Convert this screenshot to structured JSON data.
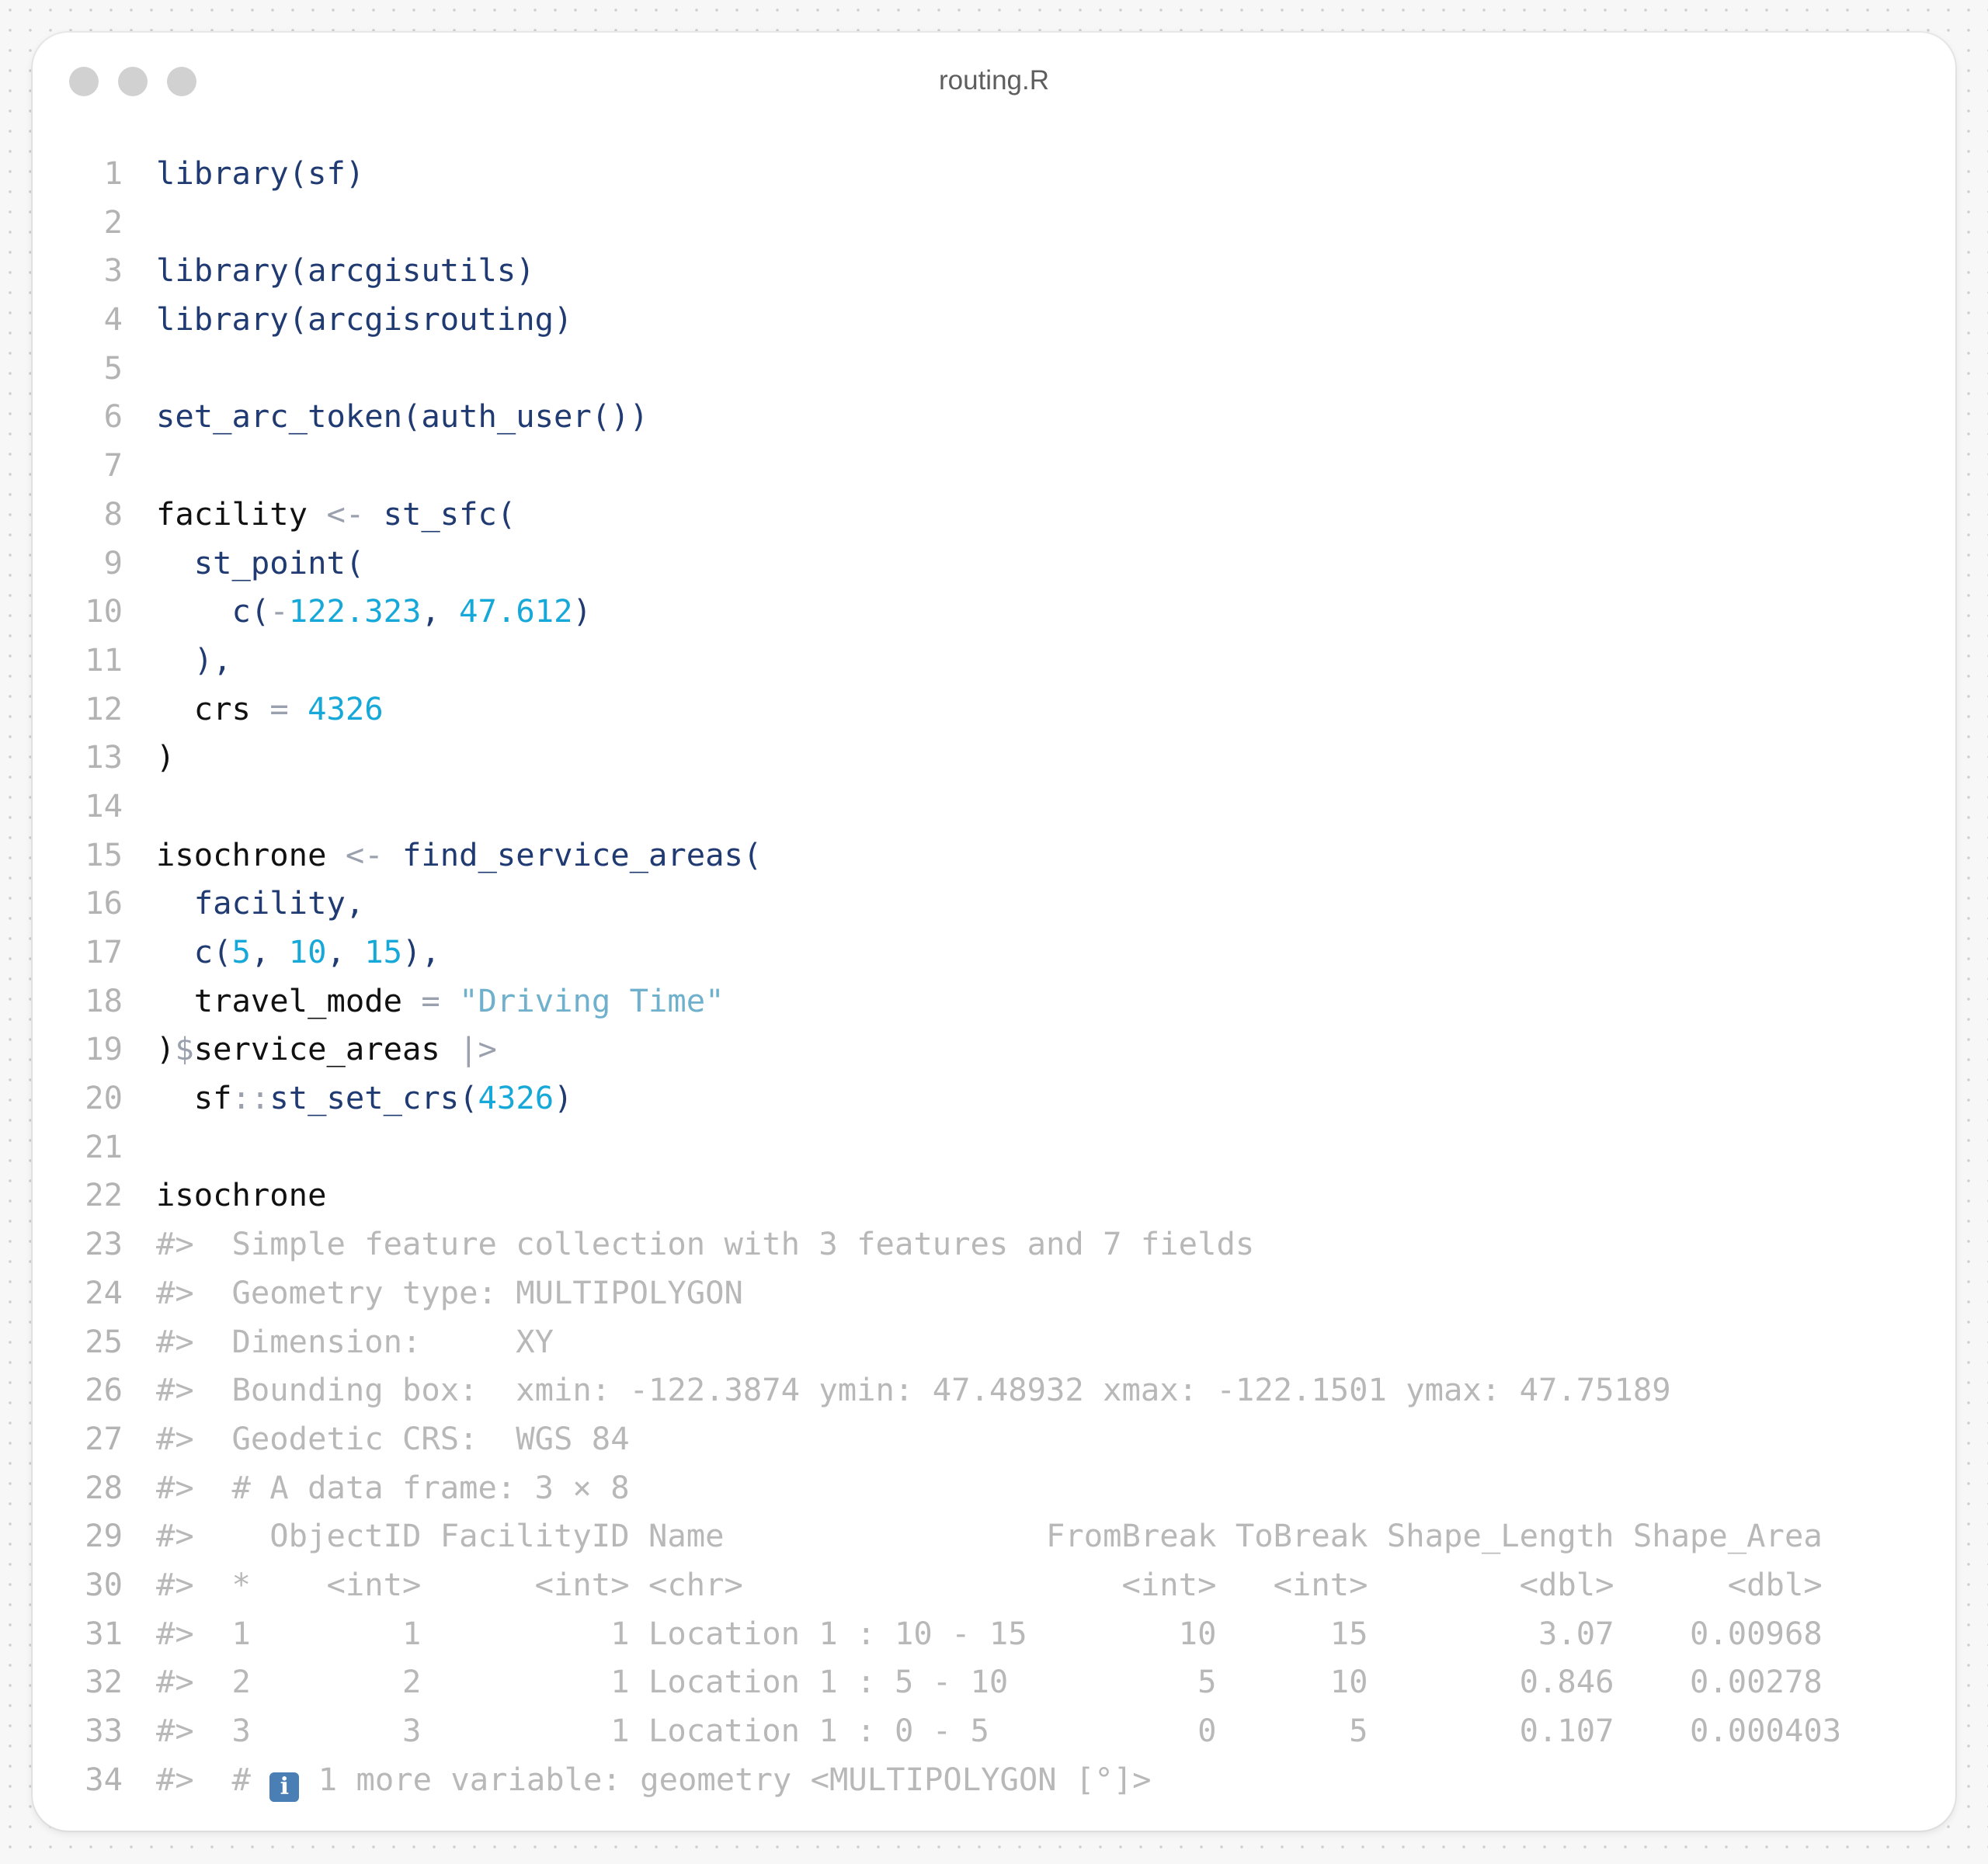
{
  "window": {
    "title": "routing.R"
  },
  "icons": {
    "info": "info-icon"
  },
  "colors": {
    "function": "#203a72",
    "identifier": "#111111",
    "number": "#16a8d8",
    "string": "#6fb1cc",
    "operator": "#9aa0ad",
    "output": "#b8b8b8",
    "line_number": "#b3b3b3"
  },
  "editor": {
    "lines": [
      {
        "n": "1",
        "tokens": [
          [
            "fn",
            "library"
          ],
          [
            "pn",
            "(sf)"
          ]
        ]
      },
      {
        "n": "2",
        "tokens": []
      },
      {
        "n": "3",
        "tokens": [
          [
            "fn",
            "library"
          ],
          [
            "pn",
            "(arcgisutils)"
          ]
        ]
      },
      {
        "n": "4",
        "tokens": [
          [
            "fn",
            "library"
          ],
          [
            "pn",
            "(arcgisrouting)"
          ]
        ]
      },
      {
        "n": "5",
        "tokens": []
      },
      {
        "n": "6",
        "tokens": [
          [
            "fn",
            "set_arc_token(auth_user())"
          ]
        ]
      },
      {
        "n": "7",
        "tokens": []
      },
      {
        "n": "8",
        "tokens": [
          [
            "id",
            "facility "
          ],
          [
            "op",
            "<-"
          ],
          [
            "fn",
            " st_sfc("
          ]
        ]
      },
      {
        "n": "9",
        "tokens": [
          [
            "fn",
            "  st_point("
          ]
        ]
      },
      {
        "n": "10",
        "tokens": [
          [
            "fn",
            "    c("
          ],
          [
            "op",
            "-"
          ],
          [
            "num",
            "122.323"
          ],
          [
            "pn",
            ", "
          ],
          [
            "num",
            "47.612"
          ],
          [
            "pn",
            ")"
          ]
        ]
      },
      {
        "n": "11",
        "tokens": [
          [
            "pn",
            "  ),"
          ]
        ]
      },
      {
        "n": "12",
        "tokens": [
          [
            "id",
            "  crs "
          ],
          [
            "op",
            "="
          ],
          [
            "id",
            " "
          ],
          [
            "num",
            "4326"
          ]
        ]
      },
      {
        "n": "13",
        "tokens": [
          [
            "id",
            ")"
          ]
        ]
      },
      {
        "n": "14",
        "tokens": []
      },
      {
        "n": "15",
        "tokens": [
          [
            "id",
            "isochrone "
          ],
          [
            "op",
            "<-"
          ],
          [
            "fn",
            " find_service_areas("
          ]
        ]
      },
      {
        "n": "16",
        "tokens": [
          [
            "fn",
            "  facility,"
          ]
        ]
      },
      {
        "n": "17",
        "tokens": [
          [
            "fn",
            "  c("
          ],
          [
            "num",
            "5"
          ],
          [
            "pn",
            ", "
          ],
          [
            "num",
            "10"
          ],
          [
            "pn",
            ", "
          ],
          [
            "num",
            "15"
          ],
          [
            "pn",
            "),"
          ]
        ]
      },
      {
        "n": "18",
        "tokens": [
          [
            "id",
            "  travel_mode "
          ],
          [
            "op",
            "="
          ],
          [
            "id",
            " "
          ],
          [
            "str",
            "\"Driving Time\""
          ]
        ]
      },
      {
        "n": "19",
        "tokens": [
          [
            "id",
            ")"
          ],
          [
            "op",
            "$"
          ],
          [
            "id",
            "service_areas "
          ],
          [
            "op",
            "|>"
          ]
        ]
      },
      {
        "n": "20",
        "tokens": [
          [
            "id",
            "  sf"
          ],
          [
            "op",
            "::"
          ],
          [
            "fn",
            "st_set_crs("
          ],
          [
            "num",
            "4326"
          ],
          [
            "pn",
            ")"
          ]
        ]
      },
      {
        "n": "21",
        "tokens": []
      },
      {
        "n": "22",
        "tokens": [
          [
            "id",
            "isochrone"
          ]
        ]
      },
      {
        "n": "23",
        "tokens": [
          [
            "out",
            "#>  Simple feature collection with 3 features and 7 fields"
          ]
        ]
      },
      {
        "n": "24",
        "tokens": [
          [
            "out",
            "#>  Geometry type: MULTIPOLYGON"
          ]
        ]
      },
      {
        "n": "25",
        "tokens": [
          [
            "out",
            "#>  Dimension:     XY"
          ]
        ]
      },
      {
        "n": "26",
        "tokens": [
          [
            "out",
            "#>  Bounding box:  xmin: -122.3874 ymin: 47.48932 xmax: -122.1501 ymax: 47.75189"
          ]
        ]
      },
      {
        "n": "27",
        "tokens": [
          [
            "out",
            "#>  Geodetic CRS:  WGS 84"
          ]
        ]
      },
      {
        "n": "28",
        "tokens": [
          [
            "out",
            "#>  # A data frame: 3 × 8"
          ]
        ]
      },
      {
        "n": "29",
        "tokens": [
          [
            "out",
            "#>    ObjectID FacilityID Name                 FromBreak ToBreak Shape_Length Shape_Area"
          ]
        ]
      },
      {
        "n": "30",
        "tokens": [
          [
            "out",
            "#>  *    <int>      <int> <chr>                    <int>   <int>        <dbl>      <dbl>"
          ]
        ]
      },
      {
        "n": "31",
        "tokens": [
          [
            "out",
            "#>  1        1          1 Location 1 : 10 - 15        10      15         3.07    0.00968"
          ]
        ]
      },
      {
        "n": "32",
        "tokens": [
          [
            "out",
            "#>  2        2          1 Location 1 : 5 - 10          5      10        0.846    0.00278"
          ]
        ]
      },
      {
        "n": "33",
        "tokens": [
          [
            "out",
            "#>  3        3          1 Location 1 : 0 - 5           0       5        0.107    0.000403"
          ]
        ]
      },
      {
        "n": "34",
        "tokens": [
          [
            "out",
            "#>  # "
          ],
          [
            "icon",
            "info-icon"
          ],
          [
            "out",
            " 1 more variable: geometry <MULTIPOLYGON [°]>"
          ]
        ]
      }
    ]
  }
}
